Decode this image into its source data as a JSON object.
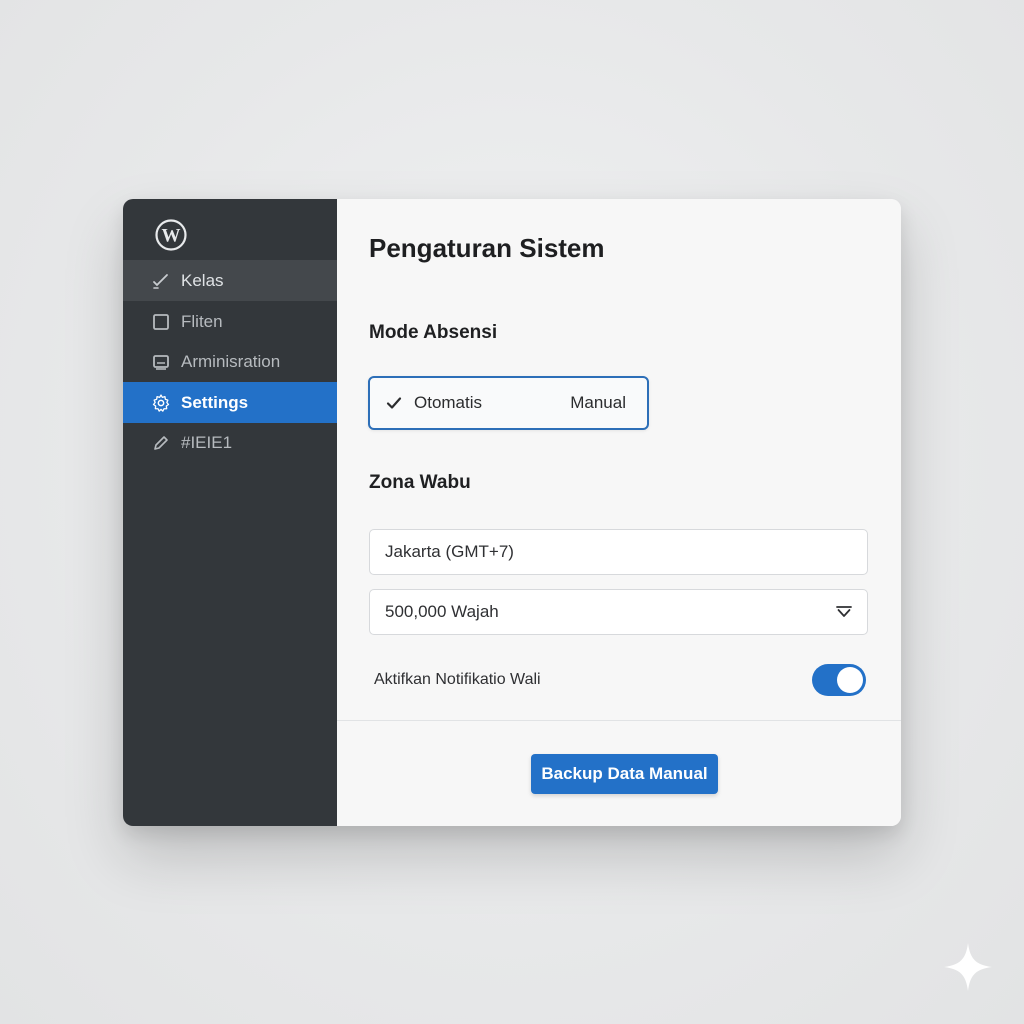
{
  "sidebar": {
    "logo_icon": "wordpress-logo-icon",
    "items": [
      {
        "label": "Kelas",
        "icon": "pencil-check-icon",
        "state": "hover"
      },
      {
        "label": "Fliten",
        "icon": "square-icon",
        "state": "normal"
      },
      {
        "label": "Arminisration",
        "icon": "monitor-icon",
        "state": "normal"
      },
      {
        "label": "Settings",
        "icon": "gear-icon",
        "state": "active"
      },
      {
        "label": "#IEIE1",
        "icon": "pen-icon",
        "state": "normal"
      }
    ]
  },
  "main": {
    "title": "Pengaturan Sistem",
    "mode": {
      "label": "Mode Absensi",
      "options": [
        "Otomatis",
        "Manual"
      ],
      "selected": "Otomatis"
    },
    "zone": {
      "label": "Zona Wabu",
      "timezone_value": "Jakarta (GMT+7)",
      "select_value": "500,000 Wajah"
    },
    "notification": {
      "label": "Aktifkan Notifikatio Wali",
      "enabled": true
    },
    "backup_button": "Backup Data Manual"
  },
  "colors": {
    "sidebar_bg": "#33373b",
    "accent": "#2371c8",
    "main_bg": "#f7f7f7"
  }
}
